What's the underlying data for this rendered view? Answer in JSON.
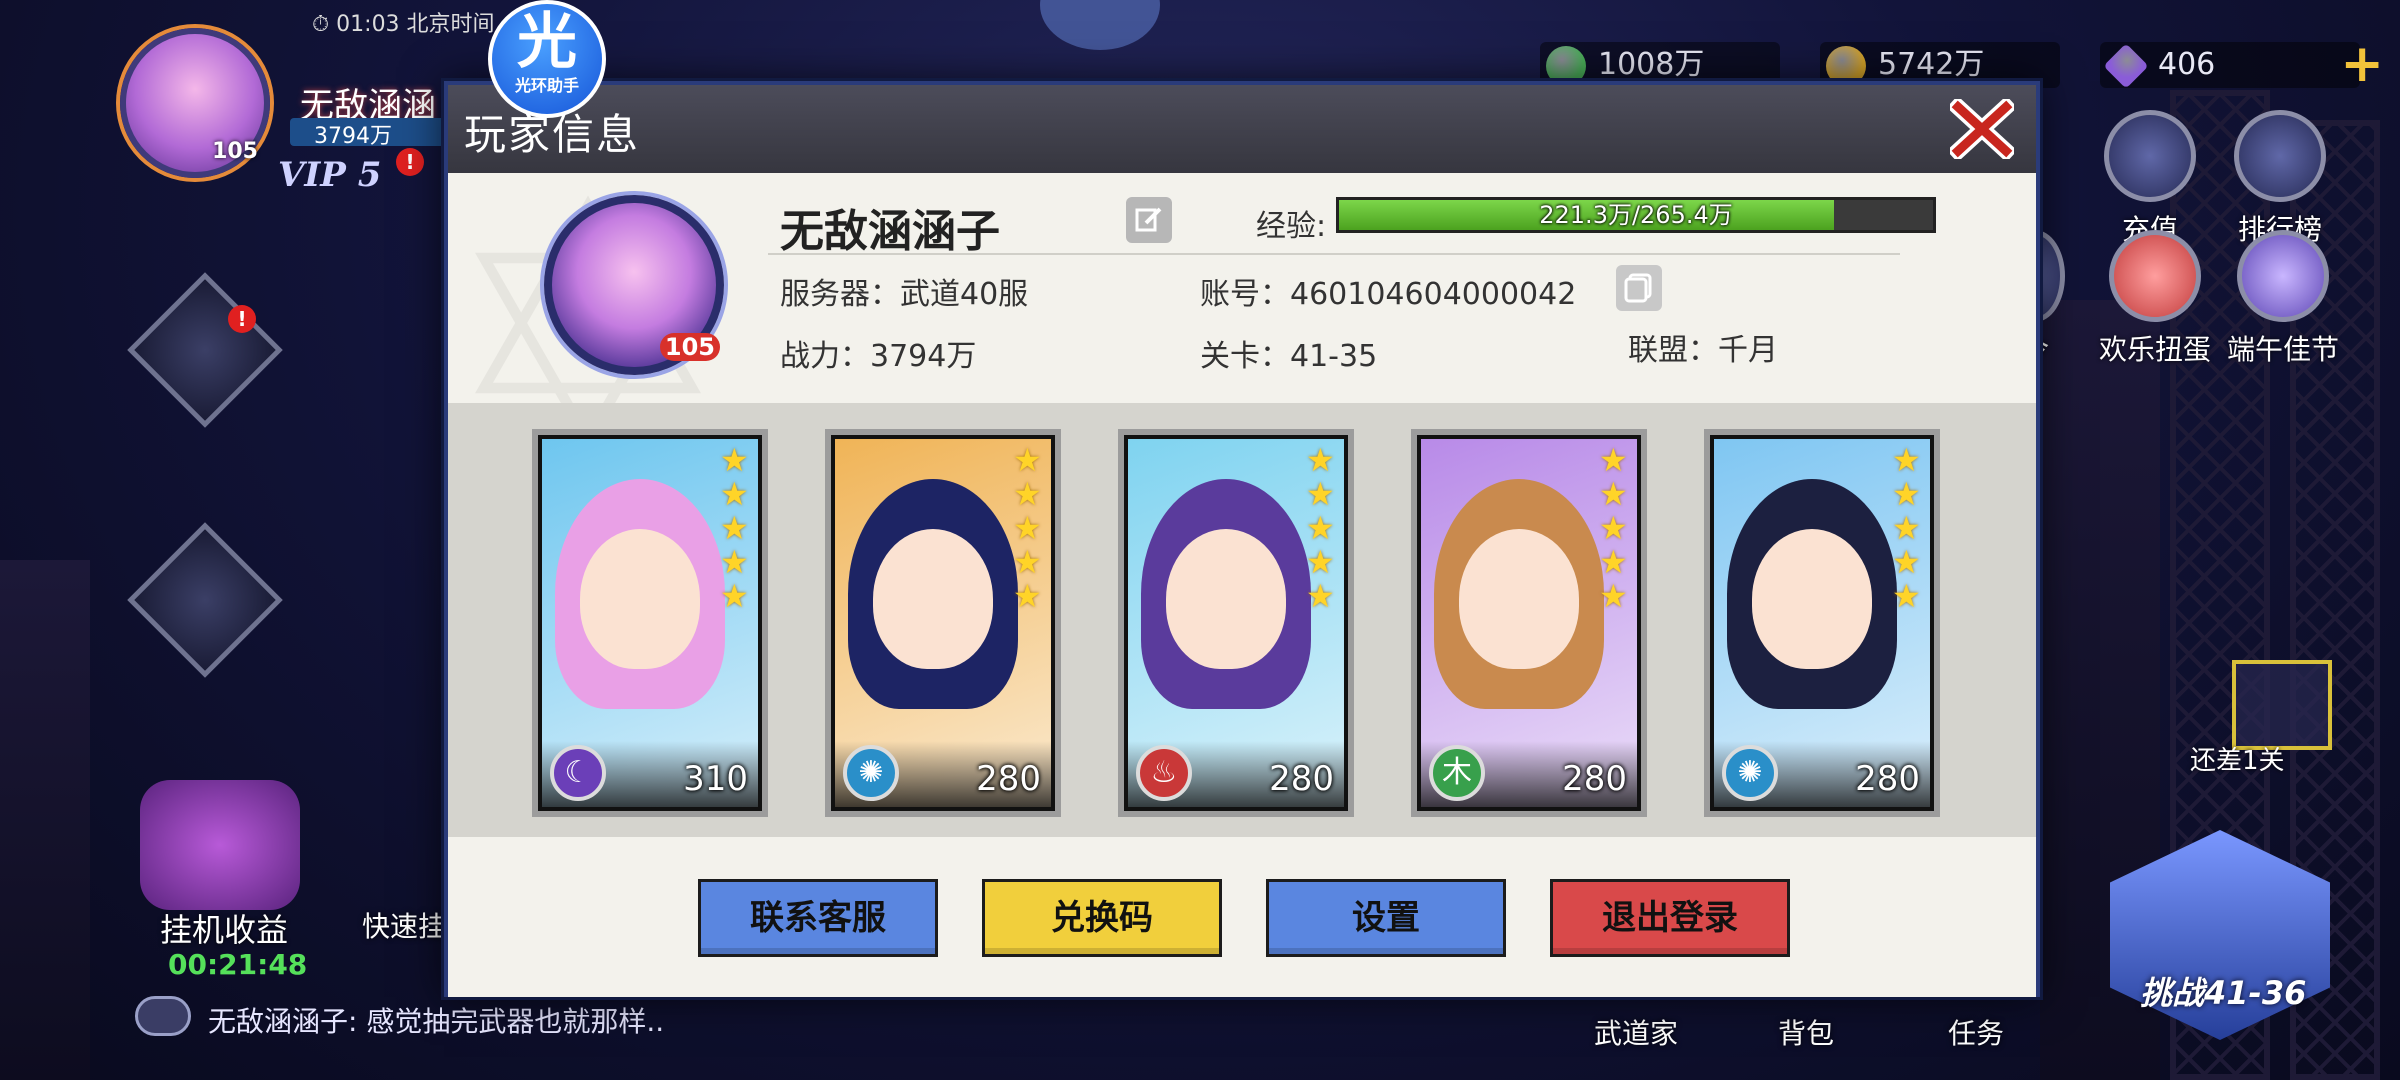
{
  "top_bar": {
    "time": "01:03 北京时间",
    "player_name": "无敌涵涵",
    "power": "3794万",
    "level": "105",
    "vip": "VIP 5",
    "red_dot": "!"
  },
  "helper": {
    "glyph": "光",
    "label": "光环助手"
  },
  "currencies": [
    {
      "value": "1008万",
      "color": "#4bb05a"
    },
    {
      "value": "5742万",
      "color": "#d4a32a"
    },
    {
      "value": "406",
      "color": "#8a5cd8"
    }
  ],
  "right_menu": [
    {
      "label": "充值"
    },
    {
      "label": "排行榜"
    },
    {
      "label": "令"
    },
    {
      "label": "欢乐扭蛋"
    },
    {
      "label": "端午佳节"
    }
  ],
  "remain_text": "还差1关",
  "idle": {
    "label": "挂机收益",
    "timer": "00:21:48"
  },
  "quick_label": "快速挂",
  "chat": {
    "text": "无敌涵涵子: 感觉抽完武器也就那样.."
  },
  "bottom_nav": [
    {
      "label": "武道家"
    },
    {
      "label": "背包"
    },
    {
      "label": "任务"
    }
  ],
  "challenge_label": "挑战41-36",
  "dialog": {
    "title": "玩家信息",
    "player": {
      "name": "无敌涵涵子",
      "level": "105",
      "exp_label": "经验:",
      "exp_text": "221.3万/265.4万",
      "exp_fraction": 0.834,
      "server": "服务器：武道40服",
      "account": "账号：460104604000042",
      "power": "战力：3794万",
      "stage": "关卡：41-35",
      "guild": "联盟：千月"
    },
    "heroes": [
      {
        "level": "310",
        "stars": 5,
        "element": "moon",
        "element_glyph": "☾",
        "element_color": "#6b3fb8",
        "bg": "#6ec6ef",
        "hair": "#e9a0e6"
      },
      {
        "level": "280",
        "stars": 5,
        "element": "wind",
        "element_glyph": "✺",
        "element_color": "#2a8fc9",
        "bg": "#f0b457",
        "hair": "#1d2464"
      },
      {
        "level": "280",
        "stars": 5,
        "element": "fire",
        "element_glyph": "♨",
        "element_color": "#c93838",
        "bg": "#7fd3f0",
        "hair": "#5a3b9c"
      },
      {
        "level": "280",
        "stars": 5,
        "element": "wood",
        "element_glyph": "木",
        "element_color": "#38a04c",
        "bg": "#b88ae8",
        "hair": "#c98a4e"
      },
      {
        "level": "280",
        "stars": 5,
        "element": "wind",
        "element_glyph": "✺",
        "element_color": "#2a8fc9",
        "bg": "#7fc6f2",
        "hair": "#1c2040"
      }
    ],
    "buttons": {
      "contact": "联系客服",
      "redeem": "兑换码",
      "settings": "设置",
      "logout": "退出登录"
    }
  }
}
